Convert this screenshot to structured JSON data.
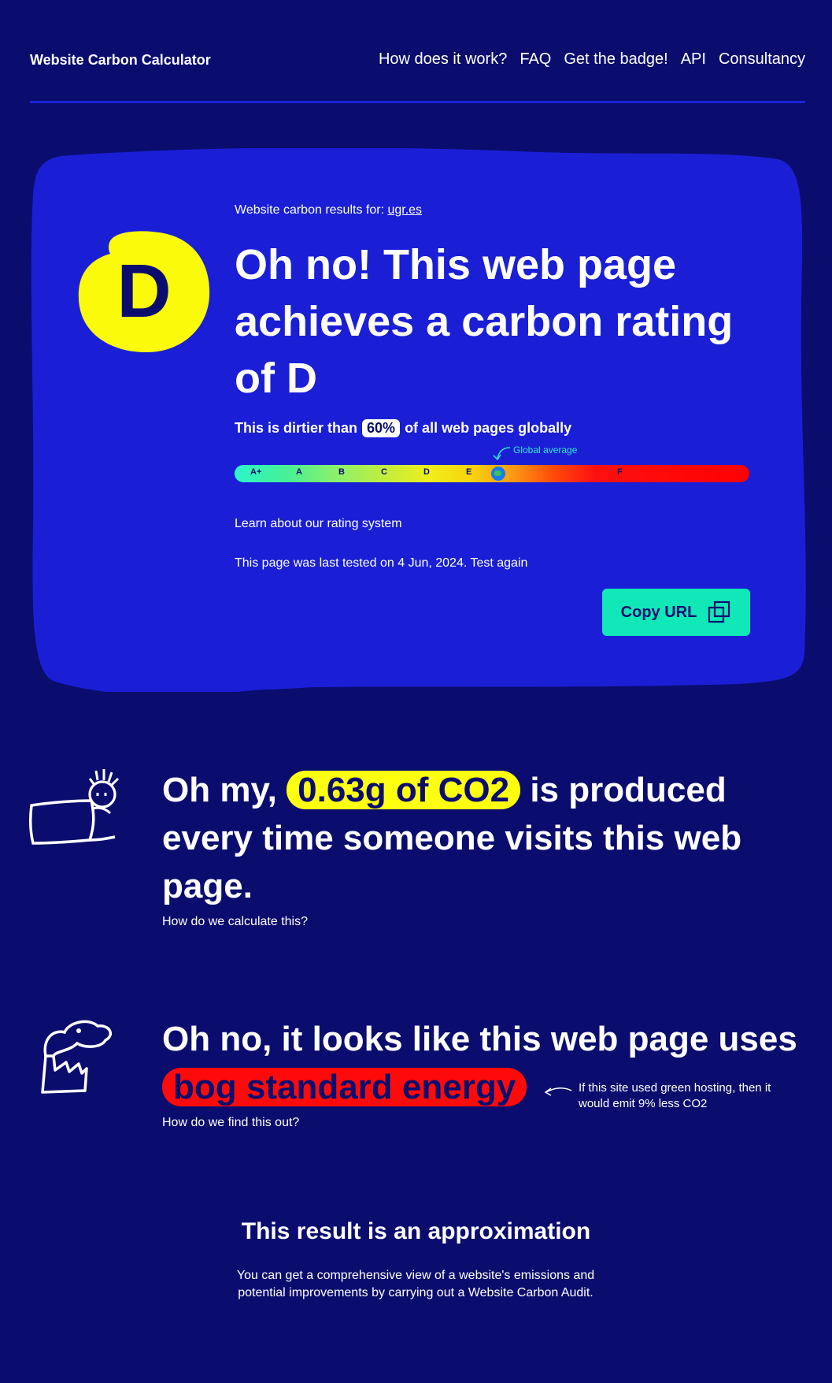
{
  "header": {
    "brand": "Website Carbon Calculator",
    "nav": [
      "How does it work?",
      "FAQ",
      "Get the badge!",
      "API",
      "Consultancy"
    ]
  },
  "result": {
    "results_for_label": "Website carbon results for:",
    "site": "ugr.es",
    "grade": "D",
    "headline": "Oh no! This web page achieves a carbon rating of D",
    "dirtier_prefix": "This is dirtier than",
    "dirtier_percent": "60%",
    "dirtier_suffix": "of all web pages globally",
    "scale_labels": [
      "A+",
      "A",
      "B",
      "C",
      "D",
      "E",
      "F"
    ],
    "global_average_label": "Global average",
    "learn_prefix": "Learn about our",
    "learn_link": "rating system",
    "tested_text": "This page was last tested on 4 Jun, 2024.",
    "test_again": "Test again",
    "copy_button": "Copy URL"
  },
  "emissions": {
    "prefix": "Oh my,",
    "amount": "0.63g of CO2",
    "suffix": "is produced every time someone visits this web page.",
    "link": "How do we calculate this?"
  },
  "energy": {
    "prefix": "Oh no, it looks like this web page uses",
    "type": "bog standard energy",
    "link": "How do we find this out?",
    "note": "If this site used green hosting, then it would emit 9% less CO2"
  },
  "approximation": {
    "title": "This result is an approximation",
    "text_prefix": "You can get a comprehensive view of a website's emissions and potential improvements by carrying out",
    "link": "a Website Carbon Audit",
    "text_suffix": "."
  },
  "colors": {
    "background": "#0a0d6e",
    "card": "#1a1fd6",
    "grade_blob": "#fafa0a",
    "copy_button": "#10e8b8",
    "highlight_yellow": "#ffff10",
    "highlight_red": "#ff0a0a"
  }
}
